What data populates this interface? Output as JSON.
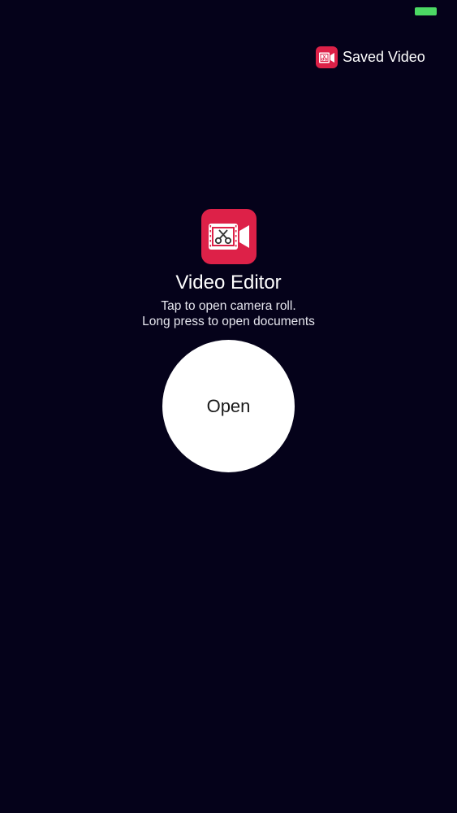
{
  "status_bar": {
    "battery_color": "#4cd964"
  },
  "header": {
    "saved_video_label": "Saved Video",
    "saved_video_icon": "video-editor-icon"
  },
  "main": {
    "app_icon": "video-editor-icon",
    "app_title": "Video Editor",
    "hint_line_1": "Tap to open camera roll.",
    "hint_line_2": "Long press to open documents",
    "open_button_label": "Open"
  },
  "colors": {
    "background": "#05021a",
    "accent": "#dd2148",
    "button_bg": "#ffffff"
  }
}
